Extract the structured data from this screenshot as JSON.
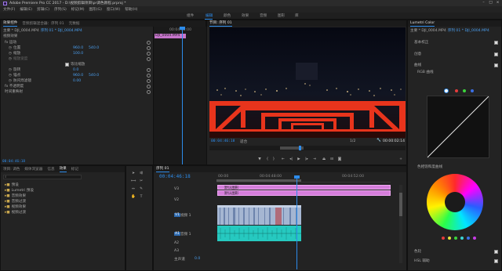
{
  "title": "Adobe Premiere Pro CC 2017 - D:\\视频剪辑项目\\pr调色教程.prproj *",
  "window_controls": [
    "–",
    "□",
    "×"
  ],
  "menu": [
    "文件(F)",
    "编辑(E)",
    "剪辑(C)",
    "序列(S)",
    "标记(M)",
    "图形(G)",
    "窗口(W)",
    "帮助(H)"
  ],
  "workspaces": [
    "组件",
    "编辑",
    "颜色",
    "效果",
    "音频",
    "图形",
    "库"
  ],
  "active_workspace": "编辑",
  "effect_controls": {
    "tabs": [
      "效果控件",
      "音频剪辑混合器：序列 01",
      "元数据"
    ],
    "source": "主要 * DJI_0004.MP4",
    "target": "序列 01 * DJI_0004.MP4",
    "section_video": "视频效果",
    "rows": [
      {
        "label": "fx  运动",
        "value": ""
      },
      {
        "label": "位置",
        "value": "960.0",
        "value2": "540.0"
      },
      {
        "label": "缩放",
        "value": "100.0",
        "value2": ""
      },
      {
        "label": "缩放宽度",
        "value": "",
        "value2": ""
      },
      {
        "label": "",
        "value": "",
        "value2": ""
      },
      {
        "label": "旋转",
        "value": "0.0",
        "value2": ""
      },
      {
        "label": "锚点",
        "value": "960.0",
        "value2": "540.0"
      },
      {
        "label": "防闪烁滤镜",
        "value": "0.00",
        "value2": ""
      },
      {
        "label": "fx  不透明度",
        "value": ""
      },
      {
        "label": "时间重映射",
        "value": ""
      }
    ],
    "uniform_scale": "等比缩放",
    "mini_clip": "DJI_0004.MP4",
    "mini_ruler": "00:04:52:00",
    "timecode": "00:04:46:18"
  },
  "program_monitor": {
    "title": "节目: 序列 01",
    "timecode": "00:04:46:18",
    "fit": "适合",
    "quality": "1/2",
    "duration": "00:00:02:14"
  },
  "project_panel": {
    "tabs": [
      "项目: 调色",
      "媒体浏览器",
      "信息",
      "效果",
      "标记"
    ],
    "items": [
      "预设",
      "Lumetri 预设",
      "音频效果",
      "音频过渡",
      "视频效果",
      "视频过渡"
    ]
  },
  "timeline": {
    "title": "序列 01",
    "timecode": "00:04:46:18",
    "ruler": [
      "00:00",
      "00:04:48:00",
      "00:04:52:00"
    ],
    "tracks_video": [
      "V3",
      "V2",
      "V1"
    ],
    "tracks_audio": [
      "A1",
      "A2",
      "A3"
    ],
    "master": "主声道",
    "master_value": "0.0",
    "v2_clips": [
      "默认图形",
      "默认图形"
    ],
    "v1_label": "视频 1",
    "a1_label": "音频 1"
  },
  "lumetri": {
    "tabs": [
      "Lumetri Color",
      "主要 * DJI_0004.MP4",
      "序列 01 * DJI_0004.MP4"
    ],
    "basic": "基本校正",
    "creative": "创意",
    "curves": "曲线",
    "rgb_curves": "RGB 曲线",
    "hue_sat": "色相饱和度曲线",
    "color_wheels": "色轮",
    "hsl": "HSL 辅助",
    "vignette": "晕影"
  },
  "colors": {
    "accent": "#2d8ceb",
    "clip_pink": "#d57edb",
    "audio_cyan": "#25c7bf",
    "video_frames": "#8fa6c9"
  }
}
